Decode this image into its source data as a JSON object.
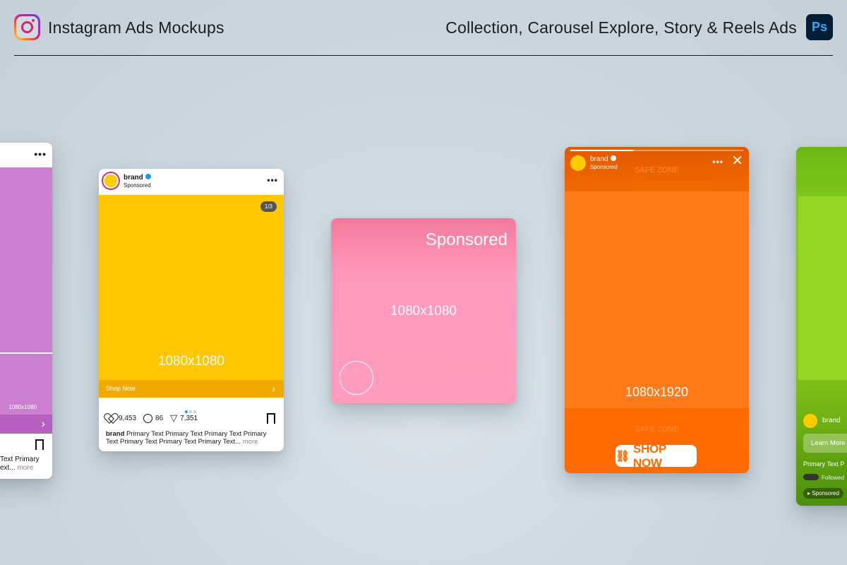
{
  "header": {
    "title": "Instagram Ads Mockups",
    "subtitle": "Collection, Carousel Explore, Story & Reels Ads",
    "ps_badge": "Ps"
  },
  "colors": {
    "purple": "#cc7fd0",
    "yellow": "#ffc700",
    "pink": "#ff9dbd",
    "orange": "#ff7a18",
    "green": "#86c819"
  },
  "collection_ad": {
    "more_icon": "•••",
    "dimension": "1080x1080",
    "cta_arrow": "›",
    "caption_line1": "Text Primary",
    "caption_line2": "ext...",
    "more": "more"
  },
  "carousel_ad": {
    "brand": "brand",
    "sponsored": "Sponsored",
    "more_icon": "•••",
    "pager": "1/3",
    "dimension": "1080x1080",
    "cta_label": "Shop Now",
    "cta_arrow": "›",
    "likes": "9,453",
    "comments": "86",
    "shares": "7,351",
    "caption_brand": "brand",
    "caption_line1": " Primary Text Primary Text Primary Text Primary",
    "caption_line2": "Text Primary Text Primary Text Primary Text...",
    "more": "more"
  },
  "explore_ad": {
    "sponsored": "Sponsored",
    "dimension": "1080x1080"
  },
  "story_ad": {
    "brand": "brand",
    "sponsored": "Sponsored",
    "more_icon": "•••",
    "close_icon": "✕",
    "safe_zone_top": "SAFE ZONE",
    "safe_zone_bottom": "SAFE ZONE",
    "dimension": "1080x1920",
    "cta_label": "SHOP NOW",
    "link_icon": "🔗"
  },
  "reels_ad": {
    "brand": "brand",
    "cta_label": "Learn More",
    "primary_text": "Primary Text P",
    "followed": "Followed",
    "sponsored": "Sponsored"
  }
}
